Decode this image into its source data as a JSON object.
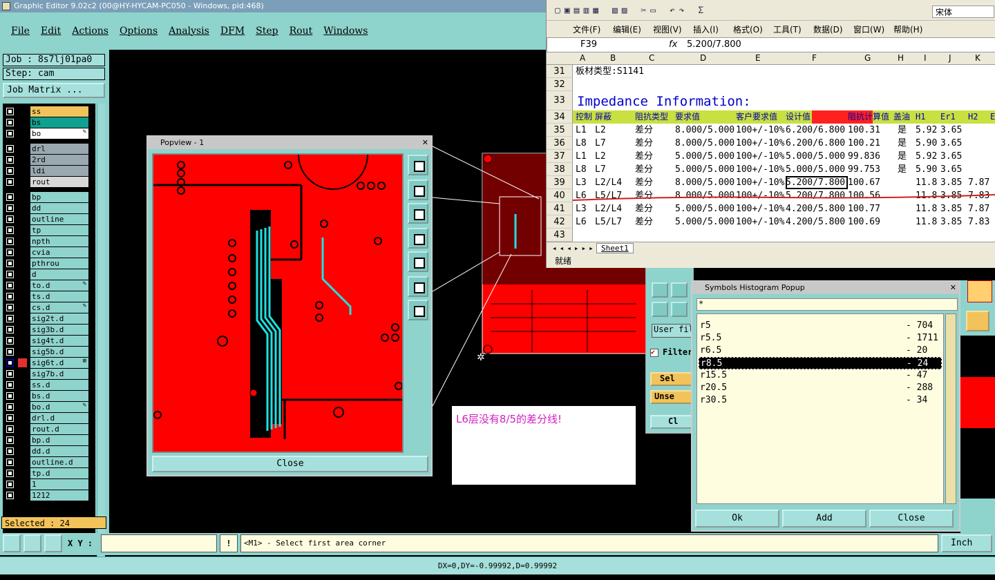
{
  "app": {
    "title": "Graphic Editor 9.02c2 (00@HY-HYCAM-PC050 - Windows, pid:468)",
    "menu": [
      "File",
      "Edit",
      "Actions",
      "Options",
      "Analysis",
      "DFM",
      "Step",
      "Rout",
      "Windows"
    ]
  },
  "left": {
    "job": "Job : 8s7lj01pa0",
    "step": "Step: cam",
    "job_matrix": "Job Matrix ...",
    "selected": "Selected : 24"
  },
  "layers": [
    {
      "name": "ss",
      "color": "#f2c35a"
    },
    {
      "name": "bs",
      "color": "#10a090"
    },
    {
      "name": "bo",
      "color": "#ffffff",
      "mark": "✎"
    },
    {
      "name": "drl",
      "color": "#9aa8b0"
    },
    {
      "name": "2rd",
      "color": "#9aa8b0"
    },
    {
      "name": "ldi",
      "color": "#9aa8b0"
    },
    {
      "name": "rout",
      "color": "#d8d8d8"
    },
    {
      "name": "bp",
      "color": "#8fd3cd"
    },
    {
      "name": "dd",
      "color": "#8fd3cd"
    },
    {
      "name": "outline",
      "color": "#8fd3cd"
    },
    {
      "name": "tp",
      "color": "#8fd3cd"
    },
    {
      "name": "npth",
      "color": "#8fd3cd"
    },
    {
      "name": "cvia",
      "color": "#8fd3cd"
    },
    {
      "name": "pthrou",
      "color": "#8fd3cd"
    },
    {
      "name": "d",
      "color": "#8fd3cd"
    },
    {
      "name": "to.d",
      "color": "#8fd3cd",
      "mark": "✎"
    },
    {
      "name": "ts.d",
      "color": "#8fd3cd"
    },
    {
      "name": "cs.d",
      "color": "#8fd3cd",
      "mark": "✎"
    },
    {
      "name": "sig2t.d",
      "color": "#8fd3cd"
    },
    {
      "name": "sig3b.d",
      "color": "#8fd3cd"
    },
    {
      "name": "sig4t.d",
      "color": "#8fd3cd"
    },
    {
      "name": "sig5b.d",
      "color": "#8fd3cd"
    },
    {
      "name": "sig6t.d",
      "color": "#8fd3cd",
      "mark": "⊞"
    },
    {
      "name": "sig7b.d",
      "color": "#8fd3cd"
    },
    {
      "name": "ss.d",
      "color": "#8fd3cd"
    },
    {
      "name": "bs.d",
      "color": "#8fd3cd"
    },
    {
      "name": "bo.d",
      "color": "#8fd3cd",
      "mark": "✎"
    },
    {
      "name": "drl.d",
      "color": "#8fd3cd"
    },
    {
      "name": "rout.d",
      "color": "#8fd3cd"
    },
    {
      "name": "bp.d",
      "color": "#8fd3cd"
    },
    {
      "name": "dd.d",
      "color": "#8fd3cd"
    },
    {
      "name": "outline.d",
      "color": "#8fd3cd"
    },
    {
      "name": "tp.d",
      "color": "#8fd3cd"
    },
    {
      "name": "1",
      "color": "#8fd3cd"
    },
    {
      "name": "1212",
      "color": "#8fd3cd"
    }
  ],
  "popview": {
    "title": "Popview - 1",
    "close": "Close"
  },
  "excel": {
    "menu": [
      "文件(F)",
      "编辑(E)",
      "视图(V)",
      "插入(I)",
      "格式(O)",
      "工具(T)",
      "数据(D)",
      "窗口(W)",
      "帮助(H)"
    ],
    "font": "宋体",
    "cellref": "F39",
    "fx": "fx",
    "formula": "5.200/7.800",
    "columns": [
      "A",
      "B",
      "C",
      "D",
      "E",
      "F",
      "G",
      "H",
      "I",
      "J",
      "K"
    ],
    "row31": "板材类型:S1141",
    "row33": "Impedance Information:",
    "headers": [
      "控制",
      "屏蔽",
      "阻抗类型",
      "要求值",
      "客户要求值",
      "设计值",
      "阻抗计算值",
      "盖油",
      "H1",
      "Er1",
      "H2",
      "E"
    ],
    "rows": [
      {
        "n": "35",
        "a": "L1",
        "b": "L2",
        "c": "差分",
        "d": "8.000/5.000",
        "e": "100+/-10%",
        "f": "6.200/6.800",
        "g": "100.31",
        "h": "是",
        "i": "5.92",
        "j": "3.65",
        "k": ""
      },
      {
        "n": "36",
        "a": "L8",
        "b": "L7",
        "c": "差分",
        "d": "8.000/5.000",
        "e": "100+/-10%",
        "f": "6.200/6.800",
        "g": "100.21",
        "h": "是",
        "i": "5.90",
        "j": "3.65",
        "k": ""
      },
      {
        "n": "37",
        "a": "L1",
        "b": "L2",
        "c": "差分",
        "d": "5.000/5.000",
        "e": "100+/-10%",
        "f": "5.000/5.000",
        "g": "99.836",
        "h": "是",
        "i": "5.92",
        "j": "3.65",
        "k": ""
      },
      {
        "n": "38",
        "a": "L8",
        "b": "L7",
        "c": "差分",
        "d": "5.000/5.000",
        "e": "100+/-10%",
        "f": "5.000/5.000",
        "g": "99.753",
        "h": "是",
        "i": "5.90",
        "j": "3.65",
        "k": ""
      },
      {
        "n": "39",
        "a": "L3",
        "b": "L2/L4",
        "c": "差分",
        "d": "8.000/5.000",
        "e": "100+/-10%",
        "f": "5.200/7.800",
        "g": "100.67",
        "h": "",
        "i": "11.8",
        "j": "3.85",
        "k": "7.87"
      },
      {
        "n": "40",
        "a": "L6",
        "b": "L5/L7",
        "c": "差分",
        "d": "8.000/5.000",
        "e": "100+/-10%",
        "f": "5.200/7.800",
        "g": "100.56",
        "h": "",
        "i": "11.8",
        "j": "3.85",
        "k": "7.83"
      },
      {
        "n": "41",
        "a": "L3",
        "b": "L2/L4",
        "c": "差分",
        "d": "5.000/5.000",
        "e": "100+/-10%",
        "f": "4.200/5.800",
        "g": "100.77",
        "h": "",
        "i": "11.8",
        "j": "3.85",
        "k": "7.87"
      },
      {
        "n": "42",
        "a": "L6",
        "b": "L5/L7",
        "c": "差分",
        "d": "5.000/5.000",
        "e": "100+/-10%",
        "f": "4.200/5.800",
        "g": "100.69",
        "h": "",
        "i": "11.8",
        "j": "3.85",
        "k": "7.83"
      }
    ],
    "row_numbers": [
      "31",
      "32",
      "33",
      "34",
      "43"
    ],
    "sheet": "Sheet1",
    "status": "就绪"
  },
  "histogram": {
    "title": "Symbols Histogram Popup",
    "filter": "*",
    "items": [
      {
        "name": "r5",
        "count": "- 704"
      },
      {
        "name": "r5.5",
        "count": "- 1711"
      },
      {
        "name": "r6.5",
        "count": "- 20"
      },
      {
        "name": "r8.5",
        "count": "- 24"
      },
      {
        "name": "r15.5",
        "count": "- 47"
      },
      {
        "name": "r20.5",
        "count": "- 288"
      },
      {
        "name": "r30.5",
        "count": "- 34"
      }
    ],
    "selected_index": 3,
    "ok": "Ok",
    "add": "Add",
    "close": "Close"
  },
  "sidepanel": {
    "user_filter": "User fil",
    "filter": "Filter",
    "sel": "Sel",
    "unsel": "Unse",
    "cl": "Cl"
  },
  "note": "L6层没有8/5的差分线!",
  "bottom": {
    "xy_label": "X Y :",
    "prompt": "<M1> - Select first area corner",
    "units": "Inch",
    "status": "DX=0,DY=-0.99992,D=0.99992"
  }
}
